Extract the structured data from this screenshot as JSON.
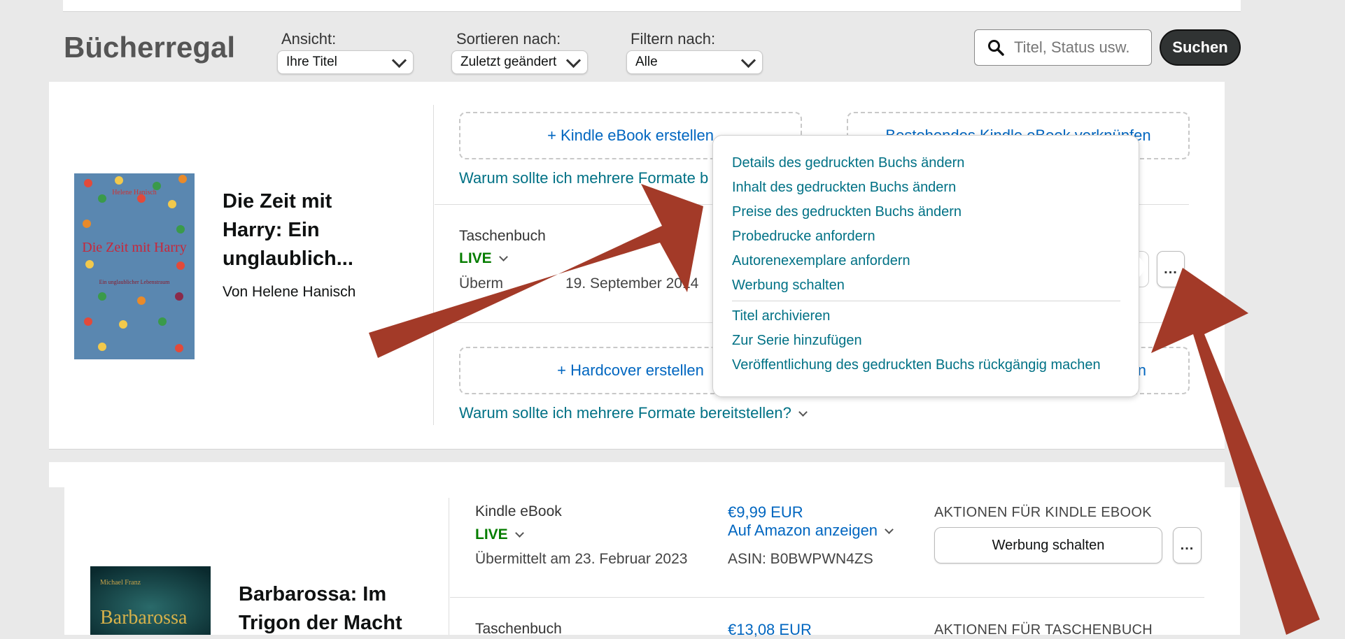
{
  "page": {
    "title": "Bücherregal"
  },
  "controls": {
    "view": {
      "label": "Ansicht:",
      "value": "Ihre Titel"
    },
    "sort": {
      "label": "Sortieren nach:",
      "value": "Zuletzt geändert"
    },
    "filter": {
      "label": "Filtern nach:",
      "value": "Alle"
    },
    "search": {
      "placeholder": "Titel, Status usw.",
      "button": "Suchen",
      "icon": "search-icon"
    }
  },
  "book1": {
    "cover_author": "Helene Hanisch",
    "cover_title": "Die Zeit mit Harry",
    "cover_subtitle": "Ein unglaublicher Lebenstraum",
    "title_lines": [
      "Die Zeit mit",
      "Harry: Ein",
      "unglaublich..."
    ],
    "author": "Von Helene Hanisch",
    "create_kindle": "+ Kindle eBook erstellen",
    "link_existing_kindle": "Bestehendes Kindle eBook verknüpfen",
    "why_formats_top": "Warum sollte ich mehrere Formate b",
    "format": "Taschenbuch",
    "status": "LIVE",
    "submitted_visible_left": "Überm",
    "submitted_visible_right": "19. September 2014",
    "create_hardcover": "+ Hardcover erstellen",
    "hardcover_link_fragment": "n",
    "why_formats_bottom": "Warum sollte ich mehrere Formate bereitstellen?",
    "more": "..."
  },
  "menu": {
    "items": [
      "Details des gedruckten Buchs ändern",
      "Inhalt des gedruckten Buchs ändern",
      "Preise des gedruckten Buchs ändern",
      "Probedrucke anfordern",
      "Autorenexemplare anfordern",
      "Werbung schalten"
    ],
    "items2": [
      "Titel archivieren",
      "Zur Serie hinzufügen",
      "Veröffentlichung des gedruckten Buchs rückgängig machen"
    ]
  },
  "book2": {
    "cover_author": "Michael Franz",
    "cover_title": "Barbarossa",
    "title_lines": [
      "Barbarossa: Im",
      "Trigon der Macht"
    ],
    "kindle": {
      "format": "Kindle eBook",
      "status": "LIVE",
      "submitted": "Übermittelt am 23. Februar 2023",
      "price": "€9,99 EUR",
      "view_on_amazon": "Auf Amazon anzeigen",
      "asin": "ASIN: B0BWPWN4ZS",
      "actions_header": "AKTIONEN FÜR KINDLE EBOOK",
      "action_button": "Werbung schalten",
      "more": "..."
    },
    "paperback": {
      "format": "Taschenbuch",
      "price": "€13,08 EUR",
      "actions_header": "AKTIONEN FÜR TASCHENBUCH"
    }
  },
  "colors": {
    "arrow": "#a33a28",
    "link": "#007185",
    "live": "#067d00",
    "button_dark": "#303333"
  }
}
